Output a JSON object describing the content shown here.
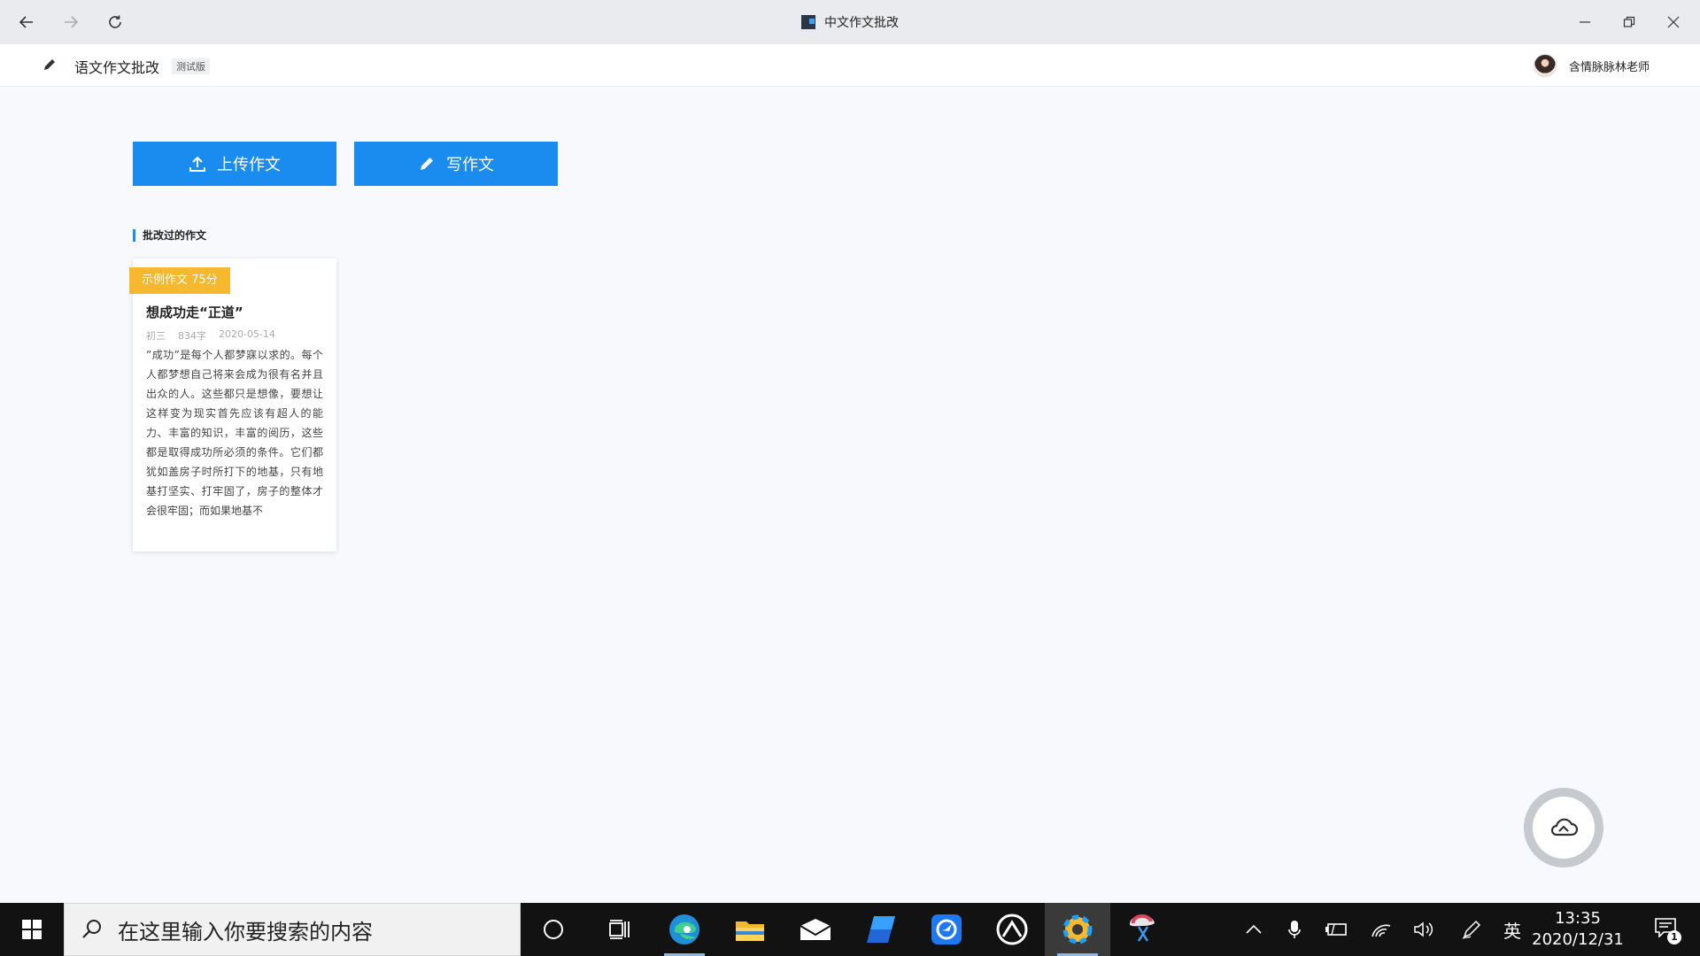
{
  "window": {
    "title": "中文作文批改",
    "nav": {
      "back_icon": "back-arrow-icon",
      "forward_icon": "forward-arrow-icon",
      "refresh_icon": "refresh-icon"
    }
  },
  "header": {
    "app_name": "语文作文批改",
    "tag": "测试版",
    "username": "含情脉脉林老师"
  },
  "actions": {
    "upload_label": "上传作文",
    "write_label": "写作文"
  },
  "section": {
    "title": "批改过的作文"
  },
  "essays": [
    {
      "badge": "示例作文 75分",
      "title": "想成功走“正道”",
      "grade": "初三",
      "words": "834字",
      "date": "2020-05-14",
      "excerpt": "”成功”是每个人都梦寐以求的。每个人都梦想自己将来会成为很有名并且出众的人。这些都只是想像，要想让这样变为现实首先应该有超人的能力、丰富的知识，丰富的阅历，这些都是取得成功所必须的条件。它们都犹如盖房子时所打下的地基，只有地基打坚实、打牢固了，房子的整体才会很牢固；而如果地基不"
    }
  ],
  "taskbar": {
    "search_placeholder": "在这里输入你要搜索的内容",
    "ime": "英",
    "time": "13:35",
    "date": "2020/12/31",
    "notifications": "1"
  },
  "colors": {
    "accent": "#1a8cf0",
    "badge": "#f5b82e",
    "page_bg": "#f7f9fd"
  }
}
